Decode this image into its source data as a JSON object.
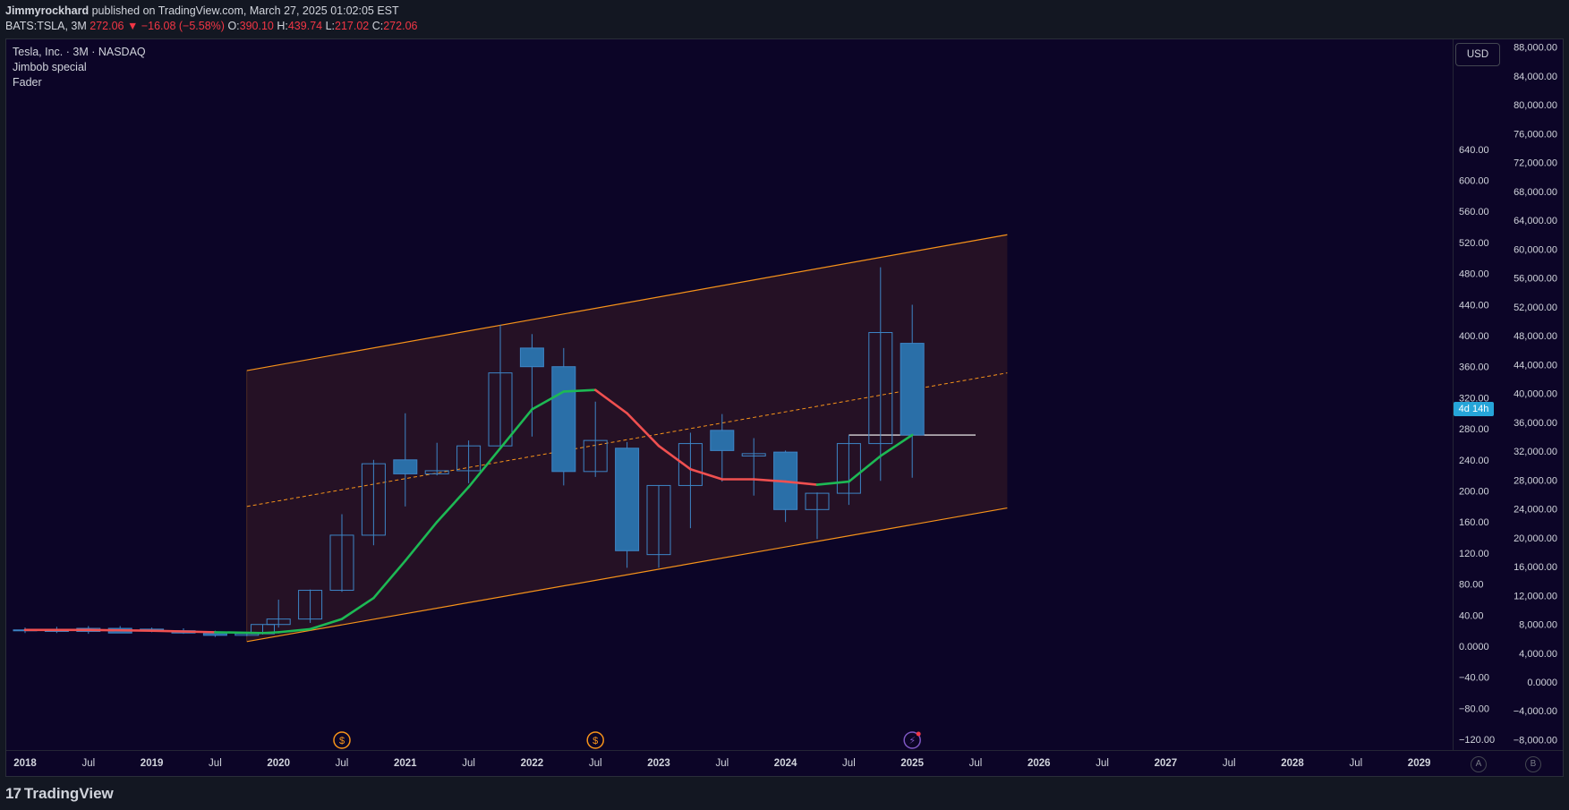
{
  "header": {
    "author": "Jimmyrockhard",
    "published_text": "published on TradingView.com, March 27, 2025 01:02:05 EST",
    "symbol_interval": "BATS:TSLA, 3M",
    "last_price": "272.06",
    "change_arrow": "▼",
    "change": "−16.08 (−5.58%)",
    "o_label": "O:",
    "o_value": "390.10",
    "h_label": "H:",
    "h_value": "439.74",
    "l_label": "L:",
    "l_value": "217.02",
    "c_label": "C:",
    "c_value": "272.06"
  },
  "legend": {
    "title": "Tesla, Inc. · 3M · NASDAQ",
    "indicator1": "Jimbob special",
    "indicator2": "Fader"
  },
  "controls": {
    "currency": "USD",
    "countdown": "4d 14h",
    "scale_a": "A",
    "scale_b": "B"
  },
  "branding": {
    "logo_text": "TradingView"
  },
  "colors": {
    "background": "#0c0527",
    "candle_fill": "#2a6fa8",
    "candle_border": "#3d85c6",
    "channel_line": "#f7931a",
    "channel_fill": "#2a1426",
    "fader_up": "#1db954",
    "fader_down": "#f05050",
    "axis_text": "#d1d4dc",
    "event_icon": "#f7931a"
  },
  "chart_data": {
    "type": "candlestick",
    "title": "Tesla, Inc. · 3M · NASDAQ",
    "interval": "3M",
    "grid": false,
    "x_tick_labels": [
      "2018",
      "Jul",
      "2019",
      "Jul",
      "2020",
      "Jul",
      "2021",
      "Jul",
      "2022",
      "Jul",
      "2023",
      "Jul",
      "2024",
      "Jul",
      "2025",
      "Jul",
      "2026",
      "Jul",
      "2027",
      "Jul",
      "2028",
      "Jul",
      "2029"
    ],
    "x_tick_years": [
      2018,
      2018.5,
      2019,
      2019.5,
      2020,
      2020.5,
      2021,
      2021.5,
      2022,
      2022.5,
      2023,
      2023.5,
      2024,
      2024.5,
      2025,
      2025.5,
      2026,
      2026.5,
      2027,
      2027.5,
      2028,
      2028.5,
      2029
    ],
    "x_range": [
      2017.95,
      2029.4
    ],
    "y_left_ticks": [
      "640.00",
      "600.00",
      "560.00",
      "520.00",
      "480.00",
      "440.00",
      "400.00",
      "360.00",
      "320.00",
      "280.00",
      "240.00",
      "200.00",
      "160.00",
      "120.00",
      "80.00",
      "40.00",
      "0.0000",
      "−40.00",
      "−80.00",
      "−120.00"
    ],
    "y_left_values": [
      640,
      600,
      560,
      520,
      480,
      440,
      400,
      360,
      320,
      280,
      240,
      200,
      160,
      120,
      80,
      40,
      0,
      -40,
      -80,
      -120
    ],
    "y_right_ticks": [
      "88,000.00",
      "84,000.00",
      "80,000.00",
      "76,000.00",
      "72,000.00",
      "68,000.00",
      "64,000.00",
      "60,000.00",
      "56,000.00",
      "52,000.00",
      "48,000.00",
      "44,000.00",
      "40,000.00",
      "36,000.00",
      "32,000.00",
      "28,000.00",
      "24,000.00",
      "20,000.00",
      "16,000.00",
      "12,000.00",
      "8,000.00",
      "4,000.00",
      "0.0000",
      "−4,000.00",
      "−8,000.00"
    ],
    "y_right_values": [
      88000,
      84000,
      80000,
      76000,
      72000,
      68000,
      64000,
      60000,
      56000,
      52000,
      48000,
      44000,
      40000,
      36000,
      32000,
      28000,
      24000,
      20000,
      16000,
      12000,
      8000,
      4000,
      0,
      -4000,
      -8000
    ],
    "y_range": [
      -120,
      700
    ],
    "candles": [
      {
        "t": 2018.0,
        "o": 20,
        "h": 24,
        "l": 17,
        "c": 21
      },
      {
        "t": 2018.25,
        "o": 21,
        "h": 25,
        "l": 17,
        "c": 19
      },
      {
        "t": 2018.5,
        "o": 19,
        "h": 26,
        "l": 16,
        "c": 23
      },
      {
        "t": 2018.75,
        "o": 23,
        "h": 26,
        "l": 19,
        "c": 17
      },
      {
        "t": 2019.0,
        "o": 22,
        "h": 24,
        "l": 18,
        "c": 20
      },
      {
        "t": 2019.25,
        "o": 20,
        "h": 23,
        "l": 16,
        "c": 17
      },
      {
        "t": 2019.5,
        "o": 17,
        "h": 20,
        "l": 12,
        "c": 14
      },
      {
        "t": 2019.75,
        "o": 14,
        "h": 18,
        "l": 13,
        "c": 16
      },
      {
        "t": 2019.875,
        "o": 16,
        "h": 28,
        "l": 15,
        "c": 28
      },
      {
        "t": 2020.0,
        "o": 28,
        "h": 60,
        "l": 24,
        "c": 35
      },
      {
        "t": 2020.25,
        "o": 35,
        "h": 73,
        "l": 30,
        "c": 72
      },
      {
        "t": 2020.5,
        "o": 72,
        "h": 170,
        "l": 70,
        "c": 143
      },
      {
        "t": 2020.75,
        "o": 143,
        "h": 240,
        "l": 130,
        "c": 235
      },
      {
        "t": 2021.0,
        "o": 240,
        "h": 300,
        "l": 180,
        "c": 222
      },
      {
        "t": 2021.25,
        "o": 222,
        "h": 262,
        "l": 220,
        "c": 226
      },
      {
        "t": 2021.5,
        "o": 226,
        "h": 265,
        "l": 210,
        "c": 258
      },
      {
        "t": 2021.75,
        "o": 258,
        "h": 414,
        "l": 258,
        "c": 352
      },
      {
        "t": 2022.0,
        "o": 384,
        "h": 402,
        "l": 270,
        "c": 360
      },
      {
        "t": 2022.25,
        "o": 360,
        "h": 384,
        "l": 207,
        "c": 225
      },
      {
        "t": 2022.5,
        "o": 225,
        "h": 315,
        "l": 218,
        "c": 265
      },
      {
        "t": 2022.75,
        "o": 255,
        "h": 263,
        "l": 101,
        "c": 123
      },
      {
        "t": 2023.0,
        "o": 118,
        "h": 207,
        "l": 101,
        "c": 207
      },
      {
        "t": 2023.25,
        "o": 207,
        "h": 275,
        "l": 152,
        "c": 261
      },
      {
        "t": 2023.5,
        "o": 278,
        "h": 299,
        "l": 212,
        "c": 252
      },
      {
        "t": 2023.75,
        "o": 245,
        "h": 268,
        "l": 194,
        "c": 248
      },
      {
        "t": 2024.0,
        "o": 250,
        "h": 252,
        "l": 160,
        "c": 176
      },
      {
        "t": 2024.25,
        "o": 176,
        "h": 198,
        "l": 138,
        "c": 197
      },
      {
        "t": 2024.5,
        "o": 197,
        "h": 272,
        "l": 182,
        "c": 261
      },
      {
        "t": 2024.75,
        "o": 261,
        "h": 488,
        "l": 213,
        "c": 404
      },
      {
        "t": 2025.0,
        "o": 390.1,
        "h": 439.74,
        "l": 217.02,
        "c": 272.06
      }
    ],
    "fader_line": [
      {
        "t": 2018.0,
        "v": 21,
        "dir": "down"
      },
      {
        "t": 2018.5,
        "v": 21,
        "dir": "down"
      },
      {
        "t": 2019.0,
        "v": 20,
        "dir": "down"
      },
      {
        "t": 2019.5,
        "v": 18,
        "dir": "down"
      },
      {
        "t": 2019.875,
        "v": 17,
        "dir": "up"
      },
      {
        "t": 2020.0,
        "v": 18,
        "dir": "up"
      },
      {
        "t": 2020.25,
        "v": 22,
        "dir": "up"
      },
      {
        "t": 2020.5,
        "v": 35,
        "dir": "up"
      },
      {
        "t": 2020.75,
        "v": 62,
        "dir": "up"
      },
      {
        "t": 2021.0,
        "v": 110,
        "dir": "up"
      },
      {
        "t": 2021.25,
        "v": 160,
        "dir": "up"
      },
      {
        "t": 2021.5,
        "v": 205,
        "dir": "up"
      },
      {
        "t": 2021.75,
        "v": 255,
        "dir": "up"
      },
      {
        "t": 2022.0,
        "v": 305,
        "dir": "up"
      },
      {
        "t": 2022.25,
        "v": 328,
        "dir": "up"
      },
      {
        "t": 2022.5,
        "v": 330,
        "dir": "up"
      },
      {
        "t": 2022.75,
        "v": 300,
        "dir": "down"
      },
      {
        "t": 2023.0,
        "v": 258,
        "dir": "down"
      },
      {
        "t": 2023.25,
        "v": 228,
        "dir": "down"
      },
      {
        "t": 2023.5,
        "v": 215,
        "dir": "down"
      },
      {
        "t": 2023.75,
        "v": 215,
        "dir": "down"
      },
      {
        "t": 2024.0,
        "v": 212,
        "dir": "down"
      },
      {
        "t": 2024.25,
        "v": 208,
        "dir": "down"
      },
      {
        "t": 2024.5,
        "v": 212,
        "dir": "up"
      },
      {
        "t": 2024.75,
        "v": 245,
        "dir": "up"
      },
      {
        "t": 2025.0,
        "v": 272,
        "dir": "up"
      }
    ],
    "channel": {
      "t_start": 2019.75,
      "t_end": 2025.75,
      "upper": [
        355,
        530
      ],
      "middle": [
        180,
        352
      ],
      "lower": [
        6,
        178
      ]
    },
    "horizontal_level": {
      "t_start": 2024.5,
      "t_end": 2025.5,
      "value": 272
    },
    "event_markers": [
      {
        "t": 2020.5,
        "kind": "dividend",
        "symbol": "$"
      },
      {
        "t": 2022.5,
        "kind": "dividend",
        "symbol": "$"
      },
      {
        "t": 2025.0,
        "kind": "earnings",
        "symbol": "⚡"
      }
    ]
  }
}
